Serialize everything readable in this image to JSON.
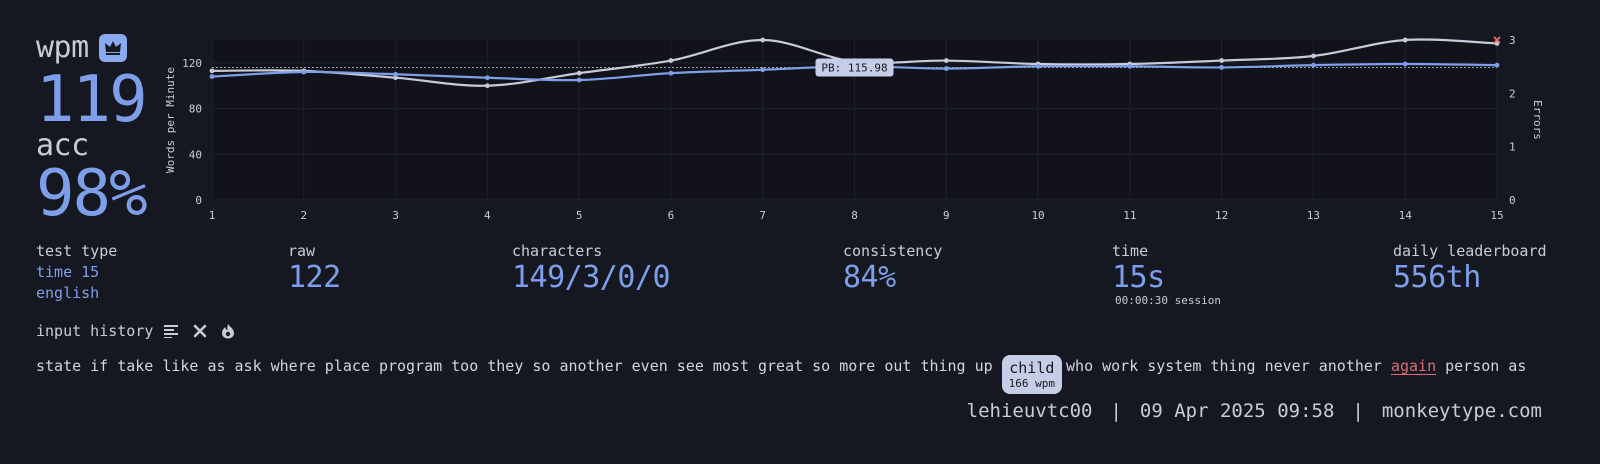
{
  "wpm": {
    "label": "wpm",
    "value": "119",
    "badge_icon": "crown-icon"
  },
  "acc": {
    "label": "acc",
    "value": "98%"
  },
  "chart_data": {
    "type": "line",
    "x": [
      1,
      2,
      3,
      4,
      5,
      6,
      7,
      8,
      9,
      10,
      11,
      12,
      13,
      14,
      15
    ],
    "series": [
      {
        "name": "wpm",
        "color": "#7d9fea",
        "values": [
          108,
          112,
          110,
          107,
          105,
          111,
          114,
          117,
          115,
          117,
          117,
          116,
          118,
          119,
          118
        ]
      },
      {
        "name": "raw",
        "color": "#c5cbd9",
        "values": [
          113,
          113,
          107,
          100,
          111,
          122,
          140,
          121,
          122,
          119,
          119,
          122,
          126,
          140,
          137
        ]
      }
    ],
    "errors": [
      {
        "x": 15,
        "value": 3
      }
    ],
    "pb": {
      "label": "PB: 115.98",
      "value": 115.98
    },
    "ylabel": "Words per Minute",
    "y2label": "Errors",
    "y_ticks": [
      "0",
      "40",
      "80",
      "120"
    ],
    "y2_ticks": [
      "0",
      "1",
      "2",
      "3"
    ],
    "ylim": [
      0,
      140
    ],
    "y2lim": [
      0,
      3
    ],
    "grid": true
  },
  "stats": {
    "test_type": {
      "label": "test type",
      "line1": "time 15",
      "line2": "english"
    },
    "raw": {
      "label": "raw",
      "value": "122"
    },
    "characters": {
      "label": "characters",
      "value": "149/3/0/0"
    },
    "consistency": {
      "label": "consistency",
      "value": "84%"
    },
    "time": {
      "label": "time",
      "value": "15s",
      "session": "00:00:30 session"
    },
    "leaderboard": {
      "label": "daily leaderboard",
      "value": "556th"
    }
  },
  "input_history": {
    "title": "input history",
    "words_before": [
      "state",
      "if",
      "take",
      "like",
      "as",
      "ask",
      "where",
      "place",
      "program",
      "too",
      "they",
      "so",
      "another",
      "even",
      "see",
      "most",
      "great",
      "so",
      "more",
      "out",
      "thing",
      "up"
    ],
    "highlighted": {
      "word": "child",
      "wpm": "166 wpm"
    },
    "words_after": [
      "who",
      "work",
      "system",
      "thing",
      "never",
      "another"
    ],
    "error_word": "again",
    "words_end": [
      "person",
      "as"
    ]
  },
  "footer": {
    "user": "lehieuvtc00",
    "date": "09 Apr 2025 09:58",
    "site": "monkeytype.com"
  }
}
